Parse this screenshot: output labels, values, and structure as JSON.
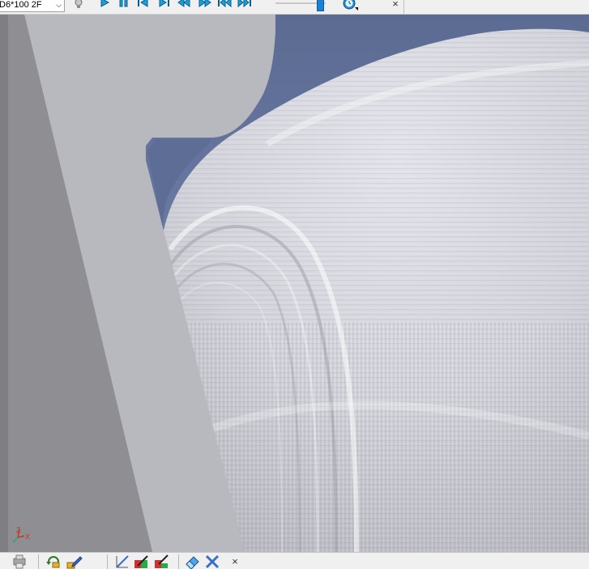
{
  "toolbar": {
    "tool_select_value": "D6*100 2F",
    "close_label": "×",
    "icons": [
      "bulb-icon",
      "play-icon",
      "pause-icon",
      "step-back-icon",
      "step-forward-icon",
      "rewind-icon",
      "fast-forward-icon",
      "go-start-icon",
      "go-end-icon",
      "clock-icon",
      "close-icon"
    ],
    "speed_level": 0.9
  },
  "viewport": {
    "background_color": "#6a7aa6",
    "stock_color": "#d3d4da",
    "fixture_color": "#b9b9bf",
    "fixture_shadow_color": "#8f8f94",
    "axis_labels": {
      "z": "Z",
      "x": "X"
    }
  },
  "bottom_toolbar": {
    "close_label": "×",
    "icons": [
      "printer-icon",
      "refresh-icon",
      "edit-pencil-icon",
      "check-collision-icon",
      "compare-model-icon",
      "measure-icon",
      "eraser-icon",
      "clear-tools-icon",
      "close-icon"
    ]
  }
}
